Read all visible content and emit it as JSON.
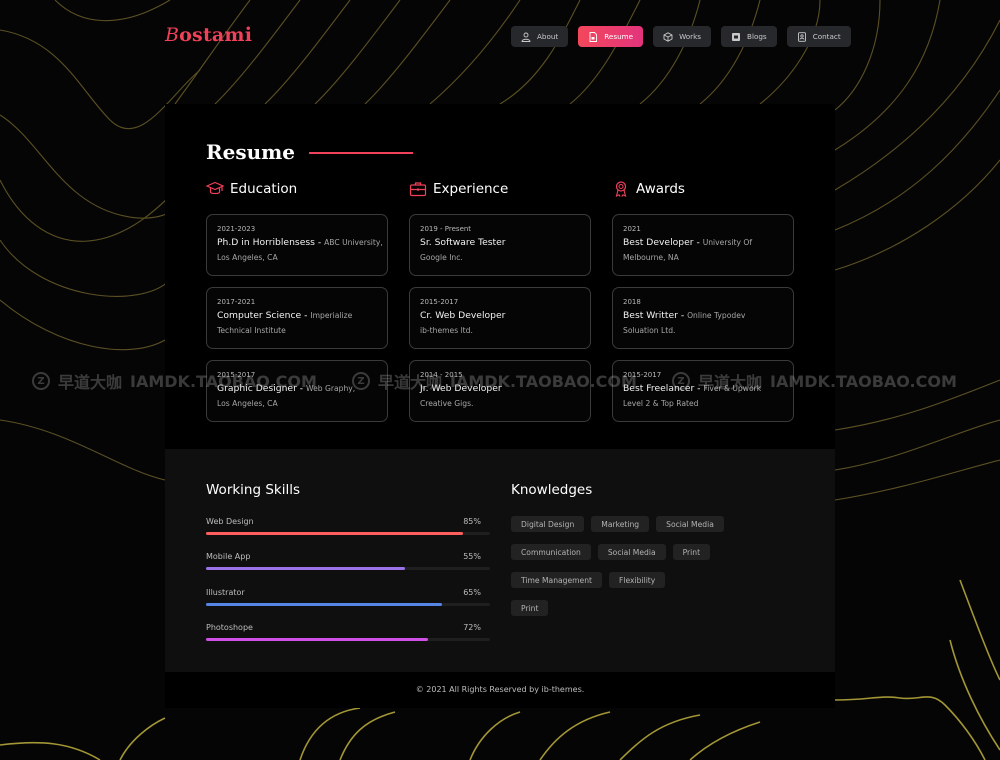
{
  "brand": {
    "logo_initial": "B",
    "logo_rest": "ostami",
    "accent": "#f0405a"
  },
  "nav": [
    {
      "label": "About",
      "icon": "user-icon",
      "active": false
    },
    {
      "label": "Resume",
      "icon": "document-icon",
      "active": true
    },
    {
      "label": "Works",
      "icon": "cube-icon",
      "active": false
    },
    {
      "label": "Blogs",
      "icon": "blog-icon",
      "active": false
    },
    {
      "label": "Contact",
      "icon": "contact-card-icon",
      "active": false
    }
  ],
  "resume": {
    "title": "Resume",
    "columns": [
      {
        "heading": "Education",
        "icon": "graduation-cap-icon",
        "items": [
          {
            "date": "2021-2023",
            "title": "Ph.D in Horriblensess",
            "sub": "ABC University,",
            "line2": "Los Angeles, CA"
          },
          {
            "date": "2017-2021",
            "title": "Computer Science",
            "sub": "Imperialize",
            "line2": "Technical Institute"
          },
          {
            "date": "2015-2017",
            "title": "Graphic Designer",
            "sub": "Web Graphy,",
            "line2": "Los Angeles, CA"
          }
        ]
      },
      {
        "heading": "Experience",
        "icon": "briefcase-icon",
        "items": [
          {
            "date": "2019 - Present",
            "title": "Sr. Software Tester",
            "sub": "",
            "line2": "Google Inc."
          },
          {
            "date": "2015-2017",
            "title": "Cr. Web Developer",
            "sub": "",
            "line2": "ib-themes ltd."
          },
          {
            "date": "2014 - 2015",
            "title": "Jr. Web Developer",
            "sub": "",
            "line2": "Creative Gigs."
          }
        ]
      },
      {
        "heading": "Awards",
        "icon": "award-ribbon-icon",
        "items": [
          {
            "date": "2021",
            "title": "Best Developer",
            "sub": "University Of",
            "line2": "Melbourne, NA"
          },
          {
            "date": "2018",
            "title": "Best Writter",
            "sub": "Online Typodev",
            "line2": "Soluation Ltd."
          },
          {
            "date": "2015-2017",
            "title": "Best Freelancer",
            "sub": "Fiver & Upwork",
            "line2": "Level 2 & Top Rated"
          }
        ]
      }
    ]
  },
  "working_skills": {
    "title": "Working Skills",
    "items": [
      {
        "label": "Web Design",
        "percent": 85,
        "percent_label": "85%",
        "color": "#ff5e5e"
      },
      {
        "label": "Mobile App",
        "percent": 55,
        "percent_label": "55%",
        "color": "#9b72e8"
      },
      {
        "label": "Illustrator",
        "percent": 65,
        "percent_label": "65%",
        "color": "#5586e6"
      },
      {
        "label": "Photoshope",
        "percent": 72,
        "percent_label": "72%",
        "color": "#cf50e6"
      }
    ],
    "bar_fill_fraction": [
      0.905,
      0.7,
      0.83,
      0.78
    ]
  },
  "knowledges": {
    "title": "Knowledges",
    "rows": [
      [
        "Digital Design",
        "Marketing",
        "Social Media"
      ],
      [
        "Communication",
        "Social Media",
        "Print"
      ],
      [
        "Time Management",
        "Flexibility"
      ],
      [
        "Print"
      ]
    ]
  },
  "footer": {
    "text": "© 2021 All Rights Reserved by ib-themes."
  },
  "watermark": {
    "brand_cn": "早道大咖",
    "site": "IAMDK.TAOBAO.COM",
    "repeat": 3
  }
}
